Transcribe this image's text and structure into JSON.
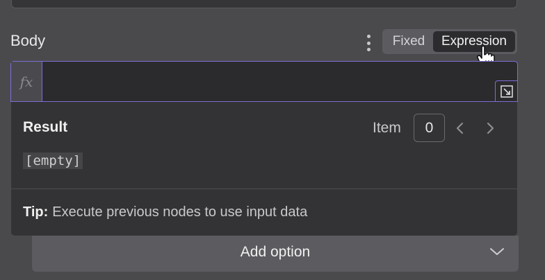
{
  "field": {
    "label": "Body",
    "mode_options": [
      "Fixed",
      "Expression"
    ],
    "selected_mode": "Expression",
    "expression_value": "",
    "fx_symbol": "fx"
  },
  "result": {
    "title": "Result",
    "item_label": "Item",
    "item_index": "0",
    "value": "[empty]"
  },
  "tip": {
    "prefix": "Tip:",
    "text": "Execute previous nodes to use input data"
  },
  "add_option": {
    "label": "Add option"
  },
  "colors": {
    "background": "#4a4a4d",
    "accent_border": "#7b6fd6",
    "panel": "#333335"
  },
  "icons": [
    "more-vertical-icon",
    "expand-icon",
    "chevron-left-icon",
    "chevron-right-icon",
    "chevron-down-icon",
    "hand-pointer-cursor-icon"
  ]
}
